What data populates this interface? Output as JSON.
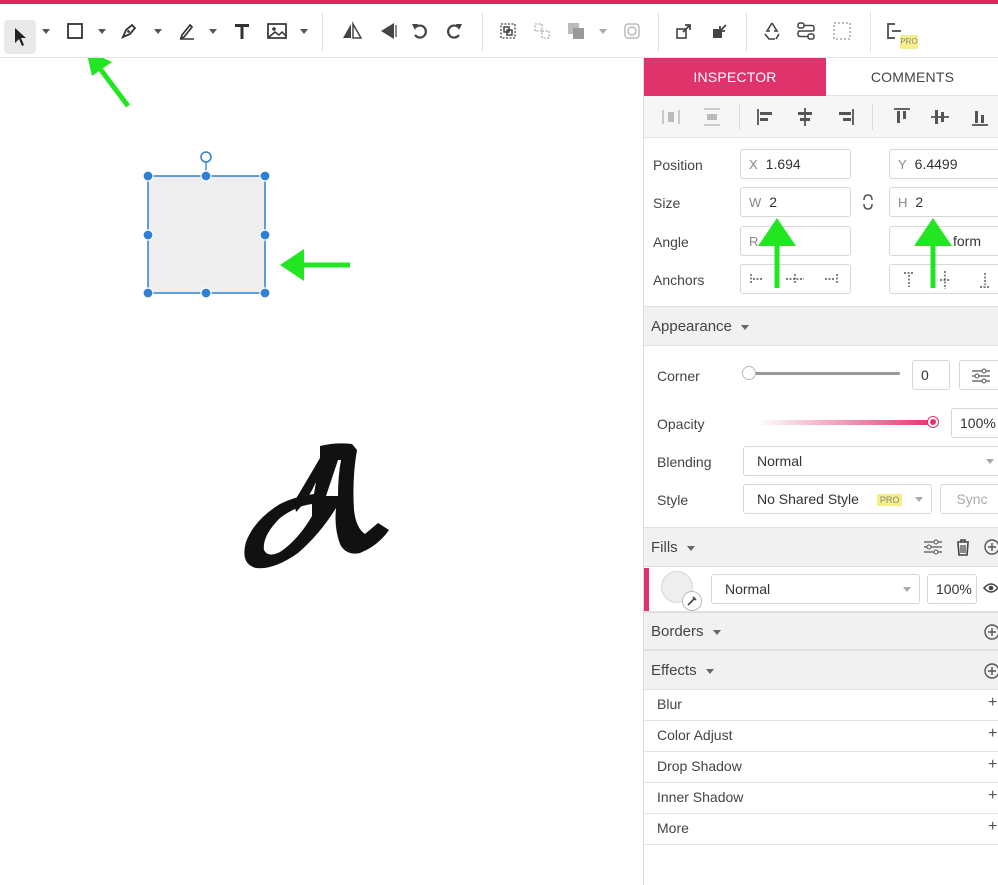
{
  "toolbar": {
    "tools": [
      "select-tool",
      "rectangle-tool",
      "pen-tool",
      "pencil-tool",
      "text-tool",
      "image-tool",
      "flip-horizontal",
      "flip-vertical",
      "rotate-left",
      "rotate-right",
      "group",
      "ungroup",
      "arrange",
      "mask",
      "export",
      "import",
      "symbol",
      "path",
      "frame",
      "pro-feature"
    ],
    "pro_badge": "PRO"
  },
  "inspector": {
    "tabs": {
      "inspector": "INSPECTOR",
      "comments": "COMMENTS"
    },
    "geometry": {
      "position_label": "Position",
      "size_label": "Size",
      "angle_label": "Angle",
      "anchors_label": "Anchors",
      "x_prefix": "X",
      "x_value": "1.694",
      "y_prefix": "Y",
      "y_value": "6.4499",
      "w_prefix": "W",
      "w_value": "2",
      "h_prefix": "H",
      "h_value": "2",
      "angle_value_fragment": "R",
      "transform_fragment": "form"
    },
    "appearance": {
      "title": "Appearance",
      "corner_label": "Corner",
      "corner_value": "0",
      "corner_slider_level": 0,
      "opacity_label": "Opacity",
      "opacity_value": "100%",
      "opacity_slider_level": 1.0,
      "blending_label": "Blending",
      "blending_value": "Normal",
      "style_label": "Style",
      "style_value": "No Shared Style",
      "style_badge": "PRO",
      "sync_label": "Sync"
    },
    "fills": {
      "title": "Fills",
      "blend_value": "Normal",
      "opacity_value": "100%"
    },
    "borders": {
      "title": "Borders"
    },
    "effects": {
      "title": "Effects",
      "items": [
        "Blur",
        "Color Adjust",
        "Drop Shadow",
        "Inner Shadow",
        "More"
      ]
    }
  },
  "colors": {
    "accent": "#e0336b",
    "selection": "#2f7fd6",
    "annotation_arrow": "#22e622",
    "shape_fill": "#eeeeee"
  }
}
